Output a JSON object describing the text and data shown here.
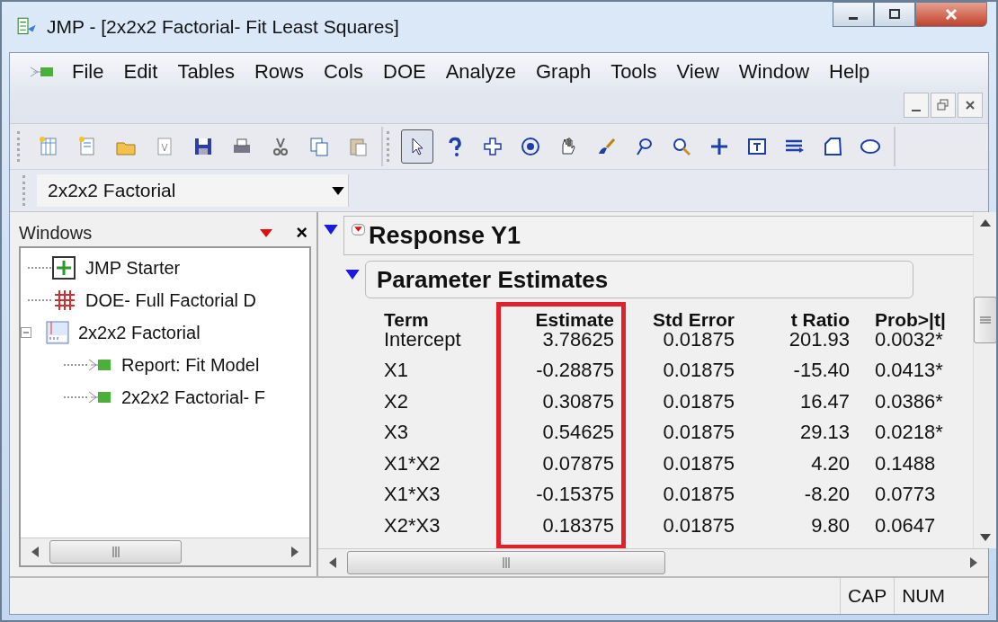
{
  "window": {
    "title": "JMP - [2x2x2 Factorial- Fit Least Squares]"
  },
  "menu": [
    "File",
    "Edit",
    "Tables",
    "Rows",
    "Cols",
    "DOE",
    "Analyze",
    "Graph",
    "Tools",
    "View",
    "Window",
    "Help"
  ],
  "toolbar": [
    {
      "selected": false
    },
    {
      "selected": false
    },
    {
      "selected": false
    },
    {
      "selected": false
    },
    {
      "selected": false
    },
    {
      "selected": false
    },
    {
      "selected": false
    },
    {
      "selected": false
    },
    {
      "selected": false
    },
    {
      "selected": true
    },
    {
      "selected": false
    },
    {
      "selected": false
    },
    {
      "selected": false
    },
    {
      "selected": false
    },
    {
      "selected": false
    },
    {
      "selected": false
    },
    {
      "selected": false
    },
    {
      "selected": false
    },
    {
      "selected": false
    },
    {
      "selected": false
    },
    {
      "selected": false
    },
    {
      "selected": false
    }
  ],
  "table_selector": {
    "value": "2x2x2 Factorial"
  },
  "windows_panel": {
    "title": "Windows",
    "close": "×",
    "items": [
      {
        "label": "JMP Starter",
        "kind": "starter"
      },
      {
        "label": "DOE- Full Factorial D",
        "kind": "doe"
      },
      {
        "label": "2x2x2 Factorial",
        "kind": "table",
        "expanded": true,
        "children": [
          {
            "label": "Report: Fit Model",
            "kind": "report"
          },
          {
            "label": "2x2x2 Factorial- F",
            "kind": "report"
          }
        ]
      }
    ]
  },
  "report": {
    "title": "Response Y1",
    "section": "Parameter Estimates",
    "columns": [
      {
        "label": "Term"
      },
      {
        "label": "Estimate",
        "highlight": true
      },
      {
        "label": "Std Error"
      },
      {
        "label": "t Ratio"
      },
      {
        "label": "Prob>|t|"
      }
    ],
    "rows": [
      [
        "Intercept",
        "3.78625",
        "0.01875",
        "201.93",
        "0.0032*"
      ],
      [
        "X1",
        "-0.28875",
        "0.01875",
        "-15.40",
        "0.0413*"
      ],
      [
        "X2",
        "0.30875",
        "0.01875",
        "16.47",
        "0.0386*"
      ],
      [
        "X3",
        "0.54625",
        "0.01875",
        "29.13",
        "0.0218*"
      ],
      [
        "X1*X2",
        "0.07875",
        "0.01875",
        "4.20",
        "0.1488"
      ],
      [
        "X1*X3",
        "-0.15375",
        "0.01875",
        "-8.20",
        "0.0773"
      ],
      [
        "X2*X3",
        "0.18375",
        "0.01875",
        "9.80",
        "0.0647"
      ]
    ]
  },
  "status_bar": [
    "CAP",
    "NUM"
  ]
}
